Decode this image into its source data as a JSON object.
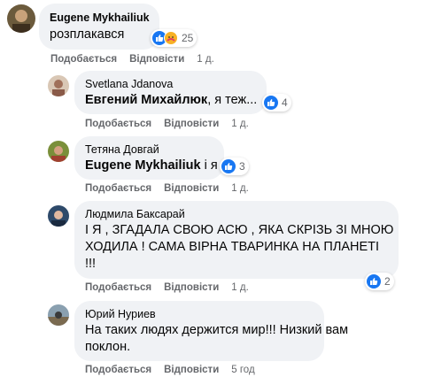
{
  "comments": [
    {
      "author": "Eugene Mykhailiuk",
      "text": "розплакався",
      "reaction_count": "25",
      "actions": {
        "like": "Подобається",
        "reply": "Відповісти",
        "time": "1 д."
      }
    },
    {
      "author": "Svetlana Jdanova",
      "mention": "Евгений Михайлюк",
      "text": ", я теж...",
      "reaction_count": "4",
      "actions": {
        "like": "Подобається",
        "reply": "Відповісти",
        "time": "1 д."
      }
    },
    {
      "author": "Тетяна Довгай",
      "mention": "Eugene Mykhailiuk",
      "text": " і я",
      "reaction_count": "3",
      "actions": {
        "like": "Подобається",
        "reply": "Відповісти",
        "time": "1 д."
      }
    },
    {
      "author": "Людмила Баксарай",
      "text_lines": [
        "І Я , ЗГАДАЛА СВОЮ АСЮ , ЯКА СКРІЗЬ ЗІ МНОЮ",
        "ХОДИЛА ! САМА ВІРНА ТВАРИНКА НА ПЛАНЕТІ",
        "!!!"
      ],
      "reaction_count": "2",
      "actions": {
        "like": "Подобається",
        "reply": "Відповісти",
        "time": "1 д."
      }
    },
    {
      "author": "Юрий Нуриев",
      "text_lines": [
        "На таких людях держится мир!!! Низкий вам",
        "поклон."
      ],
      "actions": {
        "like": "Подобається",
        "reply": "Відповісти",
        "time": "5 год"
      }
    }
  ],
  "colors": {
    "bubble": "#f0f2f5",
    "like_blue": "#1877f2",
    "meta_gray": "#65676b"
  },
  "icons": [
    "like-icon",
    "care-icon"
  ]
}
